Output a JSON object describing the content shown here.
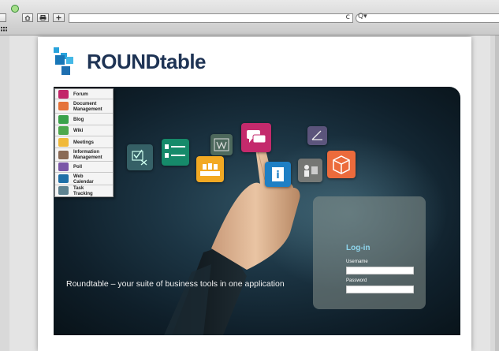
{
  "browser": {
    "url": "",
    "search_placeholder": "",
    "reload_glyph": "c",
    "search_glyph": "Q▾"
  },
  "logo": {
    "text": "ROUNDtable"
  },
  "menu": {
    "items": [
      {
        "label": "Forum",
        "icon": "forum-icon",
        "color": "#c2266a"
      },
      {
        "label": "Document Management",
        "icon": "document-icon",
        "color": "#e5733a"
      },
      {
        "label": "Blog",
        "icon": "blog-icon",
        "color": "#3aa24a"
      },
      {
        "label": "Wiki",
        "icon": "wiki-icon",
        "color": "#4da84d"
      },
      {
        "label": "Meetings",
        "icon": "meetings-icon",
        "color": "#f0b93a"
      },
      {
        "label": "Information Management",
        "icon": "information-icon",
        "color": "#8a6a55"
      },
      {
        "label": "Poll",
        "icon": "poll-icon",
        "color": "#7a57a8"
      },
      {
        "label": "Web Calendar",
        "icon": "calendar-icon",
        "color": "#1e6fa7"
      },
      {
        "label": "Task Tracking",
        "icon": "task-icon",
        "color": "#5e8290"
      }
    ]
  },
  "hero": {
    "tagline": "Roundtable – your suite of business tools in one application"
  },
  "login": {
    "title": "Log-in",
    "username_label": "Username",
    "password_label": "Password",
    "username_value": "",
    "password_value": ""
  }
}
